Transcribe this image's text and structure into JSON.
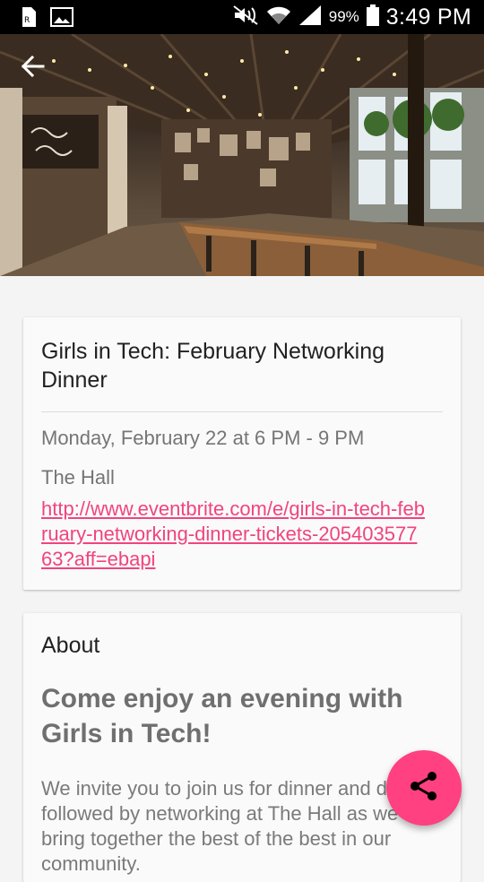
{
  "status_bar": {
    "time": "3:49 PM",
    "battery_percent": "99%",
    "icons": [
      "sim-card-icon",
      "image-icon",
      "mute-icon",
      "wifi-icon",
      "signal-icon",
      "battery-icon"
    ]
  },
  "hero": {
    "image_alt": "restaurant interior",
    "back_icon": "arrow-back-icon"
  },
  "event": {
    "title": "Girls in Tech: February Networking Dinner",
    "datetime": "Monday, February 22 at 6 PM - 9 PM",
    "venue": "The Hall",
    "link": "http://www.eventbrite.com/e/girls-in-tech-february-networking-dinner-tickets-20540357763?aff=ebapi"
  },
  "about": {
    "label": "About",
    "heading": "Come enjoy an evening with Girls in Tech!",
    "body": "We invite you to join us for dinner and drinks followed by networking at The Hall as we bring together the best of the best in our community."
  },
  "fab": {
    "icon": "share-icon"
  },
  "colors": {
    "accent": "#ff4081",
    "link": "#f0447e"
  }
}
